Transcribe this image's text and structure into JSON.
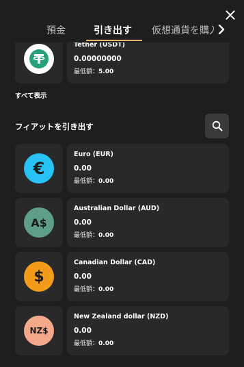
{
  "tabs": [
    {
      "label": "預金"
    },
    {
      "label": "引き出す"
    },
    {
      "label": "仮想通貨を購入"
    }
  ],
  "crypto": {
    "name": "Tether (USDT)",
    "balance": "0.00000000",
    "min_label": "最低額：",
    "min_value": "5.00"
  },
  "show_all": "すべて表示",
  "fiat_section": {
    "title": "フィアットを引き出す",
    "items": [
      {
        "name": "Euro (EUR)",
        "balance": "0.00",
        "min_label": "最低額：",
        "min_value": "0.00",
        "symbol": "€",
        "color": "#28c2f4",
        "icon": "euro-icon"
      },
      {
        "name": "Australian Dollar (AUD)",
        "balance": "0.00",
        "min_label": "最低額：",
        "min_value": "0.00",
        "symbol": "A$",
        "color": "#5f9e86",
        "icon": "aud-icon"
      },
      {
        "name": "Canadian Dollar (CAD)",
        "balance": "0.00",
        "min_label": "最低額：",
        "min_value": "0.00",
        "symbol": "$",
        "color": "#f39c1a",
        "icon": "cad-icon"
      },
      {
        "name": "New Zealand dollar (NZD)",
        "balance": "0.00",
        "min_label": "最低額：",
        "min_value": "0.00",
        "symbol": "NZ$",
        "color": "#f4a88a",
        "icon": "nzd-icon"
      }
    ]
  },
  "colors": {
    "background": "#1e1e1f",
    "card": "#29292b",
    "accent": "#e7b574",
    "tether": "#26a17b"
  }
}
